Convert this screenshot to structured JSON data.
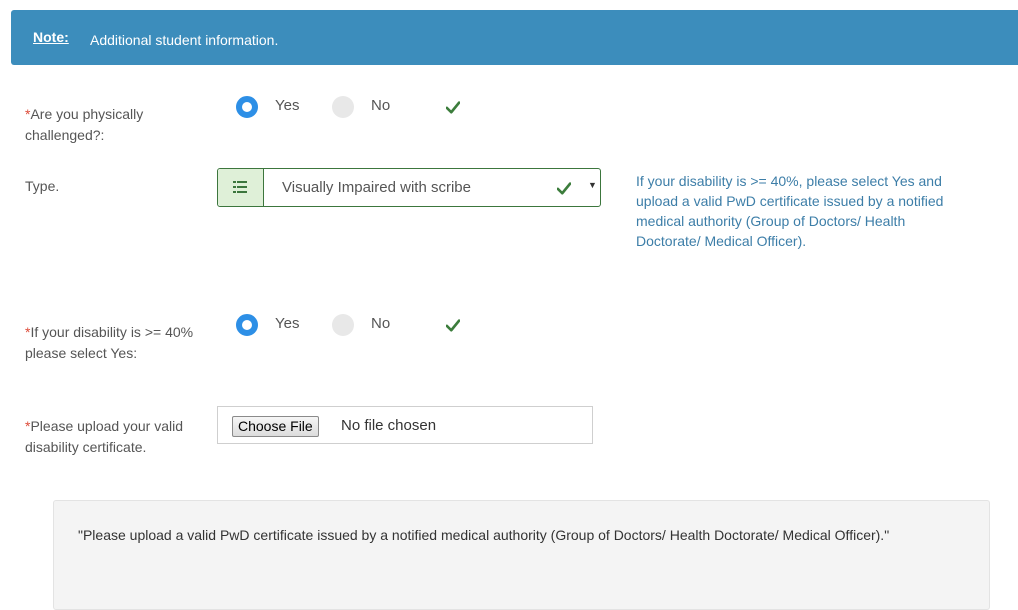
{
  "note": {
    "label": "Note:",
    "text": "Additional student information."
  },
  "physically_challenged": {
    "required_mark": "*",
    "label": "Are you physically challenged?:",
    "options": [
      "Yes",
      "No"
    ],
    "selected": "Yes"
  },
  "type": {
    "label": "Type.",
    "value": "Visually Impaired with scribe",
    "help_text": "If your disability is >= 40%, please select Yes and upload a valid PwD certificate issued by a notified medical authority (Group of Doctors/ Health Doctorate/ Medical Officer)."
  },
  "disability_40": {
    "required_mark": "*",
    "label": "If your disability is >= 40% please select Yes:",
    "options": [
      "Yes",
      "No"
    ],
    "selected": "Yes"
  },
  "upload": {
    "required_mark": "*",
    "label": "Please upload your valid disability certificate.",
    "button_label": "Choose File",
    "status": "No file chosen"
  },
  "info_box": {
    "text": "\"Please upload a valid PwD certificate issued by a notified medical authority (Group of Doctors/ Health Doctorate/ Medical Officer).\""
  },
  "colors": {
    "header_bg": "#3c8dbc",
    "radio_checked": "#2d8fe6",
    "success_green": "#3c763d",
    "help_text": "#3d7ea8",
    "required": "#dd4b39"
  },
  "icons": {
    "valid": "check-icon",
    "select_addon": "list-icon",
    "dropdown": "caret-down-icon"
  }
}
